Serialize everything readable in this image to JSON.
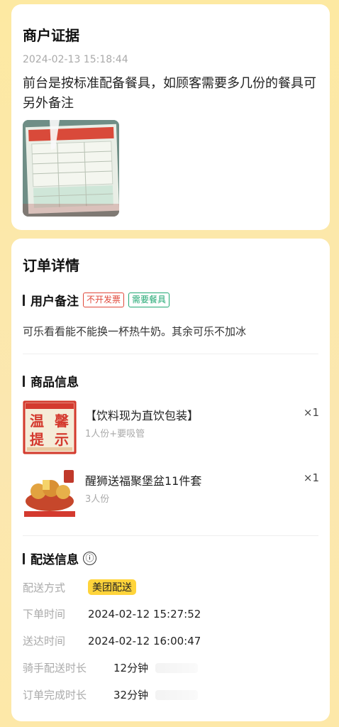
{
  "merchant_evidence": {
    "title": "商户证据",
    "timestamp": "2024-02-13 15:18:44",
    "text": "前台是按标准配备餐具，如顾客需要多几份的餐具可另外备注"
  },
  "order": {
    "title": "订单详情",
    "remarks": {
      "heading": "用户备注",
      "tags": [
        "不开发票",
        "需要餐具"
      ],
      "text": "可乐看看能不能换一杯热牛奶。其余可乐不加冰"
    },
    "goods": {
      "heading": "商品信息",
      "items": [
        {
          "name": "【饮料现为直饮包装】",
          "desc": "1人份+要吸管",
          "qty": "×1",
          "image_text": [
            "温",
            "馨",
            "提",
            "示"
          ]
        },
        {
          "name": "醒狮送福聚堡盆11件套",
          "desc": "3人份",
          "qty": "×1"
        }
      ]
    },
    "delivery": {
      "heading": "配送信息",
      "info_icon": "ⓘ",
      "rows": [
        {
          "label": "配送方式",
          "value": "美团配送"
        },
        {
          "label": "下单时间",
          "value": "2024-02-12 15:27:52"
        },
        {
          "label": "送达时间",
          "value": "2024-02-12 16:00:47"
        },
        {
          "label": "骑手配送时长",
          "value": "12分钟"
        },
        {
          "label": "订单完成时长",
          "value": "32分钟"
        }
      ]
    }
  }
}
